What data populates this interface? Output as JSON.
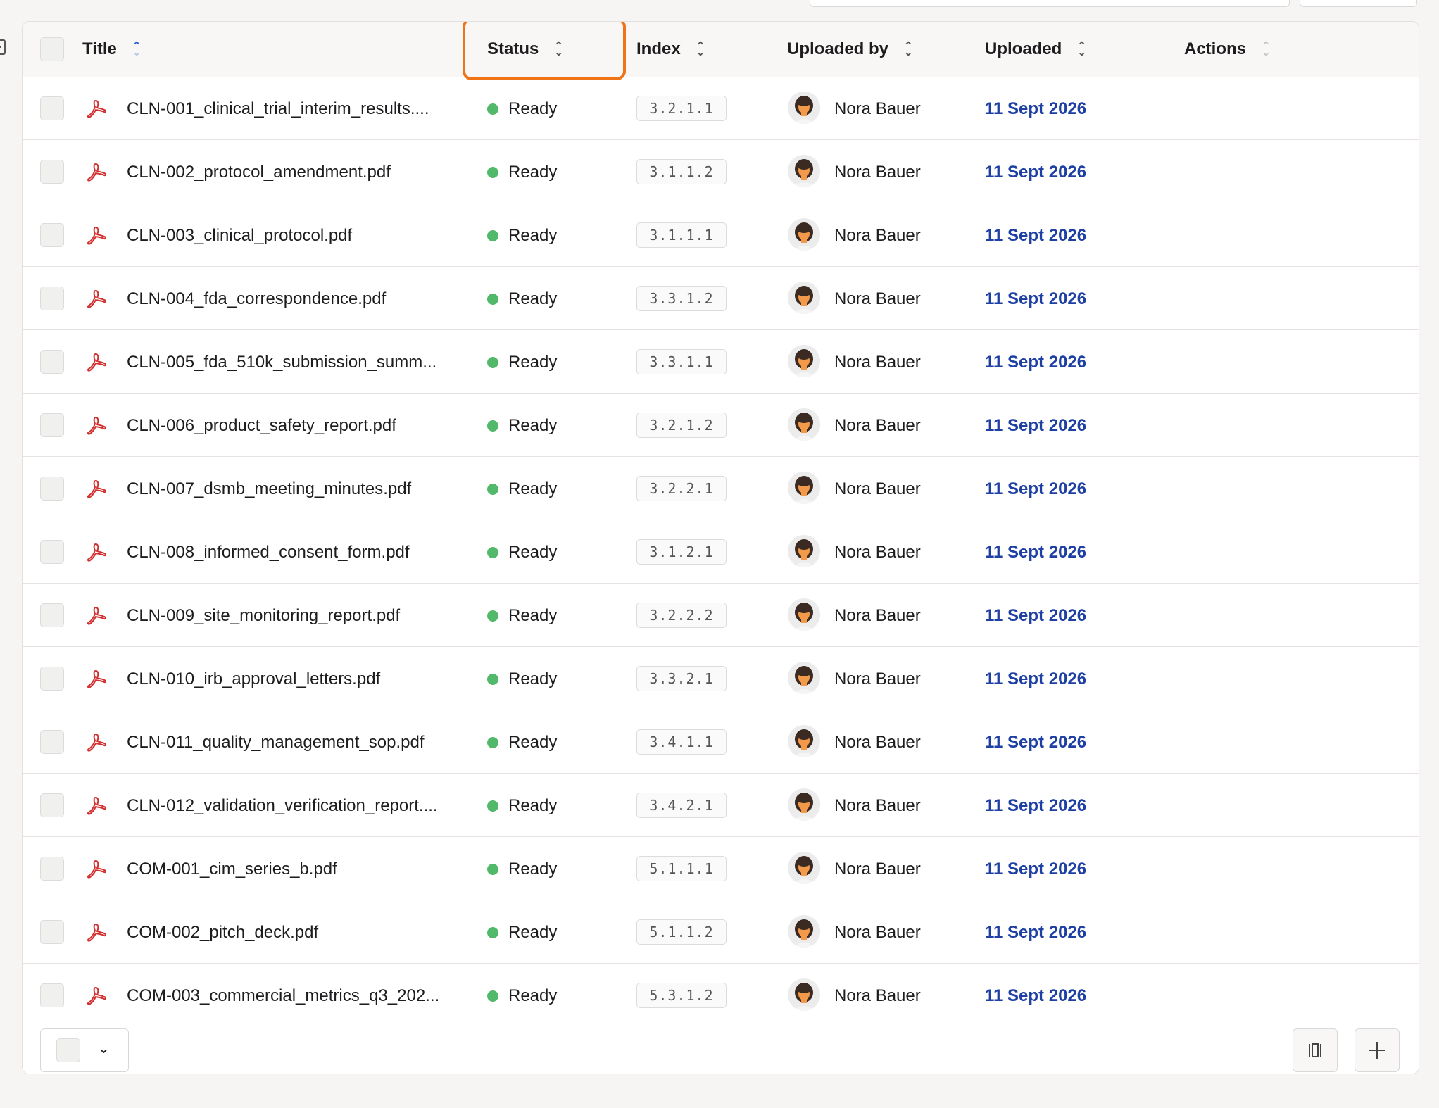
{
  "columns": {
    "title": "Title",
    "status": "Status",
    "index": "Index",
    "uploaded_by": "Uploaded by",
    "uploaded": "Uploaded",
    "actions": "Actions"
  },
  "colors": {
    "status_ready": "#52b96a",
    "date_link": "#1e3fa3",
    "highlight": "#f07415",
    "pdf_icon": "#d32f2f"
  },
  "icons": {
    "file": "pdf-icon",
    "sort": "sort-icon",
    "columns": "columns-icon",
    "add": "plus-icon"
  },
  "rows": [
    {
      "title": "CLN-001_clinical_trial_interim_results....",
      "status": "Ready",
      "index": "3.2.1.1",
      "uploaded_by": "Nora Bauer",
      "uploaded": "11 Sept 2026"
    },
    {
      "title": "CLN-002_protocol_amendment.pdf",
      "status": "Ready",
      "index": "3.1.1.2",
      "uploaded_by": "Nora Bauer",
      "uploaded": "11 Sept 2026"
    },
    {
      "title": "CLN-003_clinical_protocol.pdf",
      "status": "Ready",
      "index": "3.1.1.1",
      "uploaded_by": "Nora Bauer",
      "uploaded": "11 Sept 2026"
    },
    {
      "title": "CLN-004_fda_correspondence.pdf",
      "status": "Ready",
      "index": "3.3.1.2",
      "uploaded_by": "Nora Bauer",
      "uploaded": "11 Sept 2026"
    },
    {
      "title": "CLN-005_fda_510k_submission_summ...",
      "status": "Ready",
      "index": "3.3.1.1",
      "uploaded_by": "Nora Bauer",
      "uploaded": "11 Sept 2026"
    },
    {
      "title": "CLN-006_product_safety_report.pdf",
      "status": "Ready",
      "index": "3.2.1.2",
      "uploaded_by": "Nora Bauer",
      "uploaded": "11 Sept 2026"
    },
    {
      "title": "CLN-007_dsmb_meeting_minutes.pdf",
      "status": "Ready",
      "index": "3.2.2.1",
      "uploaded_by": "Nora Bauer",
      "uploaded": "11 Sept 2026"
    },
    {
      "title": "CLN-008_informed_consent_form.pdf",
      "status": "Ready",
      "index": "3.1.2.1",
      "uploaded_by": "Nora Bauer",
      "uploaded": "11 Sept 2026"
    },
    {
      "title": "CLN-009_site_monitoring_report.pdf",
      "status": "Ready",
      "index": "3.2.2.2",
      "uploaded_by": "Nora Bauer",
      "uploaded": "11 Sept 2026"
    },
    {
      "title": "CLN-010_irb_approval_letters.pdf",
      "status": "Ready",
      "index": "3.3.2.1",
      "uploaded_by": "Nora Bauer",
      "uploaded": "11 Sept 2026"
    },
    {
      "title": "CLN-011_quality_management_sop.pdf",
      "status": "Ready",
      "index": "3.4.1.1",
      "uploaded_by": "Nora Bauer",
      "uploaded": "11 Sept 2026"
    },
    {
      "title": "CLN-012_validation_verification_report....",
      "status": "Ready",
      "index": "3.4.2.1",
      "uploaded_by": "Nora Bauer",
      "uploaded": "11 Sept 2026"
    },
    {
      "title": "COM-001_cim_series_b.pdf",
      "status": "Ready",
      "index": "5.1.1.1",
      "uploaded_by": "Nora Bauer",
      "uploaded": "11 Sept 2026"
    },
    {
      "title": "COM-002_pitch_deck.pdf",
      "status": "Ready",
      "index": "5.1.1.2",
      "uploaded_by": "Nora Bauer",
      "uploaded": "11 Sept 2026"
    },
    {
      "title": "COM-003_commercial_metrics_q3_202...",
      "status": "Ready",
      "index": "5.3.1.2",
      "uploaded_by": "Nora Bauer",
      "uploaded": "11 Sept 2026"
    }
  ]
}
